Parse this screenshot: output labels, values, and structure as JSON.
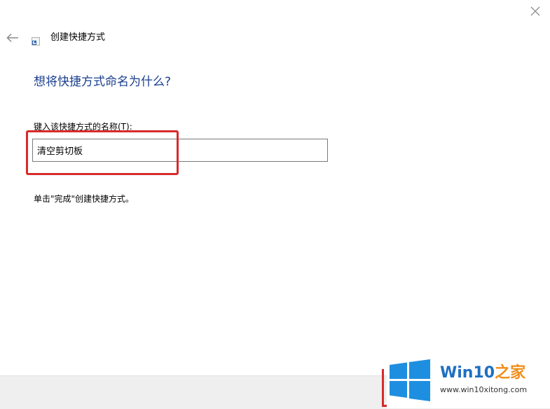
{
  "window": {
    "close_glyph": "✕"
  },
  "wizard": {
    "title": "创建快捷方式",
    "heading": "想将快捷方式命名为什么?",
    "name_label": "键入该快捷方式的名称(T):",
    "name_value": "清空剪切板",
    "hint": "单击\"完成\"创建快捷方式。"
  },
  "watermark": {
    "brand_main": "Win10",
    "brand_accent": "之家",
    "url": "www.win10xitong.com"
  },
  "icons": {
    "close": "close-icon",
    "back": "back-arrow-icon",
    "wizard": "shortcut-icon",
    "logo": "windows-logo-icon"
  },
  "colors": {
    "heading": "#1a3f8f",
    "highlight": "#d72b2b",
    "brand_blue": "#1e6fc2",
    "brand_orange": "#f08d18",
    "footer": "#efefef"
  }
}
